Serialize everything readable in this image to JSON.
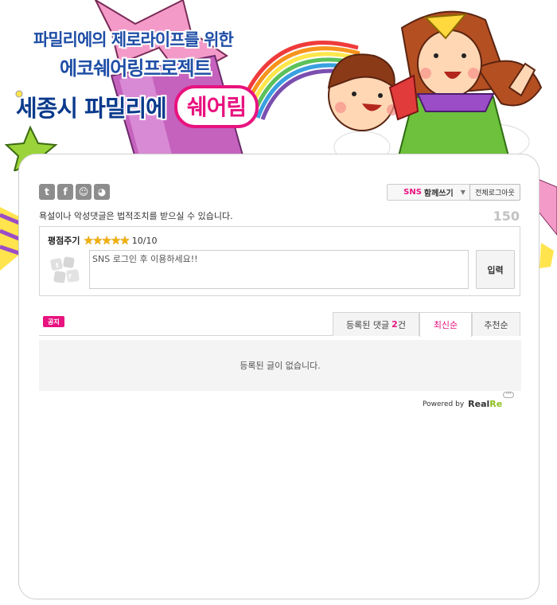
{
  "banner": {
    "line1": "파밀리에의 제로라이프를 위한",
    "line2": "에코쉐어링프로젝트",
    "line3": "세종시 파밀리에",
    "line3_highlight": "쉐어림"
  },
  "sns_icons": [
    {
      "icon": "twitter-icon",
      "glyph": "t"
    },
    {
      "icon": "facebook-icon",
      "glyph": "f"
    },
    {
      "icon": "me2day-icon",
      "glyph": "☺"
    },
    {
      "icon": "yozm-icon",
      "glyph": "◕"
    }
  ],
  "toolbar": {
    "sns_share_prefix": "SNS",
    "sns_share_label": "함께쓰기",
    "logout_all_label": "전체로그아웃"
  },
  "notice_text": "욕설이나 악성댓글은 법적조치를 받으실 수 있습니다.",
  "char_counter": "150",
  "rating": {
    "label": "평점주기",
    "stars_filled": 5,
    "stars_total": 5,
    "value_text": "10/10"
  },
  "comment": {
    "placeholder": "SNS 로그인 후 이용하세요!!",
    "submit_label": "입력"
  },
  "notice_badge": "공지",
  "tabs": [
    {
      "label": "등록된 댓글",
      "count": "2",
      "suffix": "건"
    },
    {
      "label": "최신순"
    },
    {
      "label": "추천순"
    }
  ],
  "empty_message": "등록된 글이 없습니다.",
  "footer": {
    "powered_by": "Powered by",
    "brand_main": "Real",
    "brand_accent": "Re"
  },
  "colors": {
    "accent_pink": "#e8137f",
    "headline_blue": "#1f4ea6",
    "star_gold": "#f2b10a",
    "brand_green": "#8dbf1f"
  }
}
